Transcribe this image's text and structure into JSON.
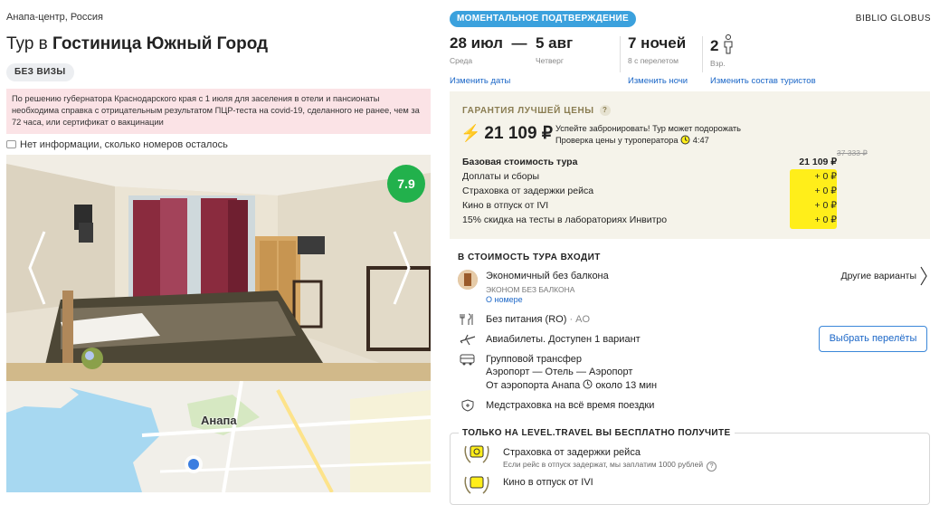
{
  "hotel": {
    "location": "Анапа-центр, Россия",
    "title_prefix": "Тур в",
    "title_name": "Гостиница Южный Город",
    "visa_badge": "БЕЗ ВИЗЫ",
    "warning": "По решению губернатора Краснодарского края с 1 июля для заселения в отели и пансионаты необходима справка с отрицательным результатом ПЦР-теста на covid-19, сделанного не ранее, чем за 72 часа, или сертификат о вакцинации",
    "rooms_info": "Нет информации, сколько номеров осталось",
    "rating": "7.9",
    "map_city": "Анапа"
  },
  "tour": {
    "badge": "МОМЕНТАЛЬНОЕ ПОДТВЕРЖДЕНИЕ",
    "operator": "BIBLIO GLOBUS",
    "date_from": "28 июл",
    "date_dash": "—",
    "date_to": "5 авг",
    "day_from": "Среда",
    "day_to": "Четверг",
    "nights": "7 ночей",
    "nights_sub": "8 с перелетом",
    "tourists": "2",
    "tourists_sub": "Взр.",
    "change_dates": "Изменить даты",
    "change_nights": "Изменить ночи",
    "change_tourists": "Изменить состав туристов"
  },
  "guarantee": {
    "title": "ГАРАНТИЯ ЛУЧШЕЙ ЦЕНЫ",
    "help": "?",
    "price": "21 109 ₽",
    "note1": "Успейте забронировать! Тур может подорожать",
    "note2": "Проверка цены у туроператора",
    "timer": "4:47",
    "old_price": "37 333 ₽",
    "rows": [
      {
        "label": "Базовая стоимость тура",
        "value": "21 109 ₽"
      },
      {
        "label": "Доплаты и сборы",
        "value": "+ 0 ₽"
      },
      {
        "label": "Страховка от задержки рейса",
        "value": "+ 0 ₽"
      },
      {
        "label": "Кино в отпуск от IVI",
        "value": "+ 0 ₽"
      },
      {
        "label": "15% скидка на тесты в лабораториях Инвитро",
        "value": "+ 0 ₽"
      }
    ],
    "highlight_color": "#ffee1a"
  },
  "included": {
    "title": "В СТОИМОСТЬ ТУРА ВХОДИТ",
    "room_name": "Экономичный без балкона",
    "room_sub": "ЭКОНОМ БЕЗ БАЛКОНА",
    "room_link": "О номере",
    "other_options": "Другие варианты",
    "meal": "Без питания (RO)",
    "meal_code": "· AO",
    "flights": "Авиабилеты. Доступен 1 вариант",
    "choose_flights": "Выбрать перелёты",
    "transfer1": "Групповой трансфер",
    "transfer2": "Аэропорт — Отель — Аэропорт",
    "transfer3": "От аэропорта Анапа",
    "transfer_time": "около 13 мин",
    "insurance": "Медстраховка на всё время поездки"
  },
  "free": {
    "title": "ТОЛЬКО НА LEVEL.TRAVEL ВЫ БЕСПЛАТНО ПОЛУЧИТЕ",
    "item1": "Страховка от задержки рейса",
    "item1_sub": "Если рейс в отпуск задержат, мы заплатим 1000 рублей",
    "item2": "Кино в отпуск от IVI"
  },
  "colors": {
    "accent_blue": "#3ba1dd",
    "link_blue": "#1a66c7",
    "rating_green": "#22b14c",
    "warning_bg": "#fbe3e6",
    "guarantee_bg": "#f5f3ea"
  }
}
